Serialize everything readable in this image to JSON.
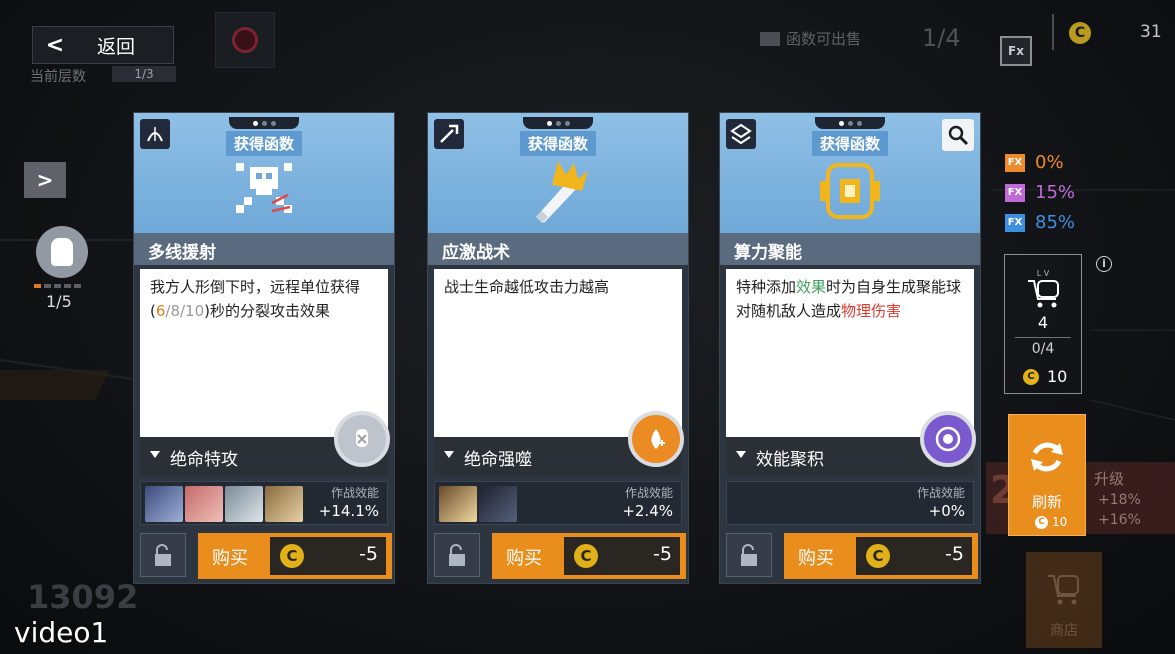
{
  "header": {
    "back_label": "返回",
    "layer_label": "当前层数",
    "layer_count": "1/3",
    "sell_label": "函数可出售",
    "sell_count": "1/4",
    "fx_icon": "Fx",
    "coin_symbol": "C",
    "coins": "31"
  },
  "left": {
    "progress_text": "1/5",
    "progress_filled": 1,
    "progress_total": 5,
    "score": "13092"
  },
  "video_label": "video1",
  "cards": [
    {
      "acquire_label": "获得函数",
      "type_icon": "ranged-icon",
      "name": "多线援射",
      "desc_parts": [
        {
          "text": "我方人形倒下时，远程单位获得(",
          "color": ""
        },
        {
          "text": "6",
          "color": "orange"
        },
        {
          "text": "/8/10",
          "color": "grey"
        },
        {
          "text": ")秒的分裂攻击效果",
          "color": ""
        }
      ],
      "skill_label": "绝命特攻",
      "effect_label": "作战效能",
      "effect_value": "+14.1%",
      "buy_label": "购买",
      "coin_symbol": "C",
      "price": "-5"
    },
    {
      "acquire_label": "获得函数",
      "type_icon": "melee-icon",
      "name": "应激战术",
      "desc_parts": [
        {
          "text": "战士生命越低攻击力越高",
          "color": ""
        }
      ],
      "skill_label": "绝命强噬",
      "effect_label": "作战效能",
      "effect_value": "+2.4%",
      "buy_label": "购买",
      "coin_symbol": "C",
      "price": "-5"
    },
    {
      "acquire_label": "获得函数",
      "type_icon": "special-icon",
      "name": "算力聚能",
      "desc_parts": [
        {
          "text": "特种添加",
          "color": ""
        },
        {
          "text": "效果",
          "color": "green"
        },
        {
          "text": "时为自身生成聚能球对随机敌人造成",
          "color": ""
        },
        {
          "text": "物理伤害",
          "color": "red"
        }
      ],
      "skill_label": "效能聚积",
      "effect_label": "作战效能",
      "effect_value": "+0%",
      "buy_label": "购买",
      "coin_symbol": "C",
      "price": "-5"
    }
  ],
  "right": {
    "fx_tag": "FX",
    "fx_rates": [
      {
        "value": "0%",
        "color": "#ef8a2e"
      },
      {
        "value": "15%",
        "color": "#c06ad8"
      },
      {
        "value": "85%",
        "color": "#3f8fe0"
      }
    ],
    "info_symbol": "i",
    "shop_lv_label": "L V",
    "shop_level": "4",
    "shop_count": "0/4",
    "coin_symbol": "C",
    "shop_cost": "10",
    "refresh_label": "刷新",
    "refresh_cost": "10",
    "upgrade_title": "升级",
    "upgrade_digit": "2",
    "upgrade_a": "+18%",
    "upgrade_b": "+16%",
    "shop_label": "商店"
  }
}
